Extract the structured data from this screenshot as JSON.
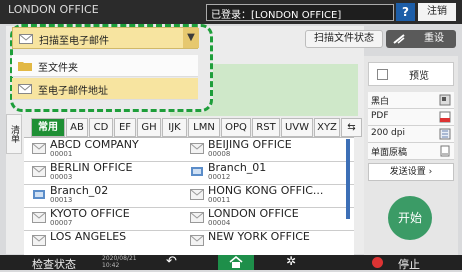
{
  "topbar": {
    "title": "LONDON OFFICE",
    "login": "已登录：[LONDON OFFICE]",
    "help_label": "?",
    "logout_label": "注销"
  },
  "actions": {
    "scan_status_label": "扫描文件状态",
    "reset_label": "重设"
  },
  "dropdown": {
    "selected": "扫描至电子邮件",
    "items": [
      {
        "label": "至文件夹",
        "icon": "folder-icon"
      },
      {
        "label": "至电子邮件地址",
        "icon": "email-icon"
      }
    ]
  },
  "left_tab_label": "清单",
  "index_tabs": [
    "常用",
    "AB",
    "CD",
    "EF",
    "GH",
    "IJK",
    "LMN",
    "OPQ",
    "RST",
    "UVW",
    "XYZ"
  ],
  "address_entries": [
    {
      "name": "ABCD COMPANY",
      "number": "00001",
      "icon": "email-icon"
    },
    {
      "name": "BEIJING OFFICE",
      "number": "00008",
      "icon": "email-icon"
    },
    {
      "name": "BERLIN OFFICE",
      "number": "00003",
      "icon": "email-icon"
    },
    {
      "name": "Branch_01",
      "number": "00012",
      "icon": "network-icon"
    },
    {
      "name": "Branch_02",
      "number": "00013",
      "icon": "network-icon"
    },
    {
      "name": "HONG KONG OFFIC...",
      "number": "00011",
      "icon": "email-icon"
    },
    {
      "name": "KYOTO OFFICE",
      "number": "00007",
      "icon": "email-icon"
    },
    {
      "name": "LONDON OFFICE",
      "number": "00004",
      "icon": "email-icon"
    },
    {
      "name": "LOS ANGELES",
      "number": "",
      "icon": "email-icon"
    },
    {
      "name": "NEW YORK OFFICE",
      "number": "",
      "icon": "email-icon"
    }
  ],
  "right_panel": {
    "preview_label": "预览",
    "settings": [
      {
        "label": "黑白",
        "icon": "color-mode-icon"
      },
      {
        "label": "PDF",
        "icon": "pdf-icon"
      },
      {
        "label": "200 dpi",
        "icon": "resolution-icon"
      },
      {
        "label": "单面原稿",
        "icon": "original-icon"
      }
    ],
    "send_settings_label": "发送设置",
    "start_label": "开始"
  },
  "bottombar": {
    "status_label": "检查状态",
    "date": "2020/08/21",
    "time": "10:42",
    "stop_label": "停止"
  },
  "colors": {
    "accent_green": "#1e8f34",
    "dropdown_highlight": "#f7e4a0",
    "topbar_bg": "#2b2b2b",
    "start_button": "#3b9b66"
  }
}
